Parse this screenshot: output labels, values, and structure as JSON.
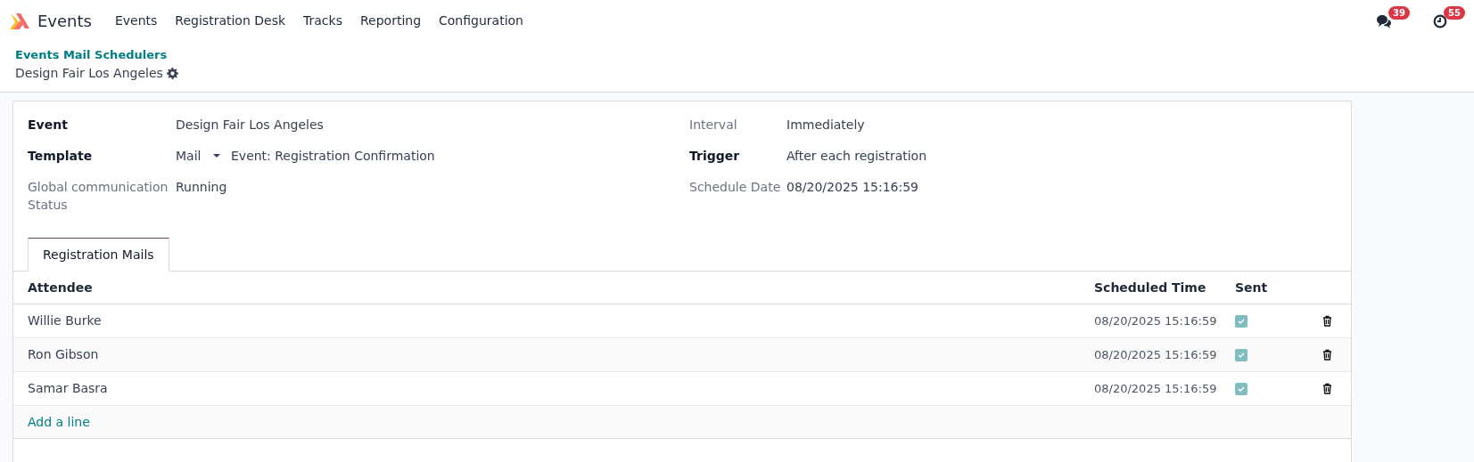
{
  "navbar": {
    "app_name": "Events",
    "menu": [
      "Events",
      "Registration Desk",
      "Tracks",
      "Reporting",
      "Configuration"
    ],
    "messages_badge": "39",
    "activities_badge": "55"
  },
  "breadcrumb": {
    "parent": "Events Mail Schedulers",
    "current": "Design Fair Los Angeles"
  },
  "form": {
    "left_fields": [
      {
        "label": "Event",
        "value": "Design Fair Los Angeles",
        "bold": true
      },
      {
        "label": "Template",
        "prefix": "Mail",
        "value": "Event: Registration Confirmation",
        "bold": true
      },
      {
        "label": "Global communication Status",
        "value": "Running",
        "bold": false
      }
    ],
    "right_fields": [
      {
        "label": "Interval",
        "value": "Immediately",
        "bold": false
      },
      {
        "label": "Trigger",
        "value": "After each registration",
        "bold": true
      },
      {
        "label": "Schedule Date",
        "value": "08/20/2025 15:16:59",
        "bold": false
      }
    ]
  },
  "tabs": [
    {
      "label": "Registration Mails",
      "selected": true
    }
  ],
  "table": {
    "columns": [
      "Attendee",
      "Scheduled Time",
      "Sent"
    ],
    "rows": [
      {
        "attendee": "Willie Burke",
        "scheduled_time": "08/20/2025 15:16:59",
        "sent": true
      },
      {
        "attendee": "Ron Gibson",
        "scheduled_time": "08/20/2025 15:16:59",
        "sent": true
      },
      {
        "attendee": "Samar Basra",
        "scheduled_time": "08/20/2025 15:16:59",
        "sent": true
      }
    ],
    "add_line": "Add a line"
  }
}
